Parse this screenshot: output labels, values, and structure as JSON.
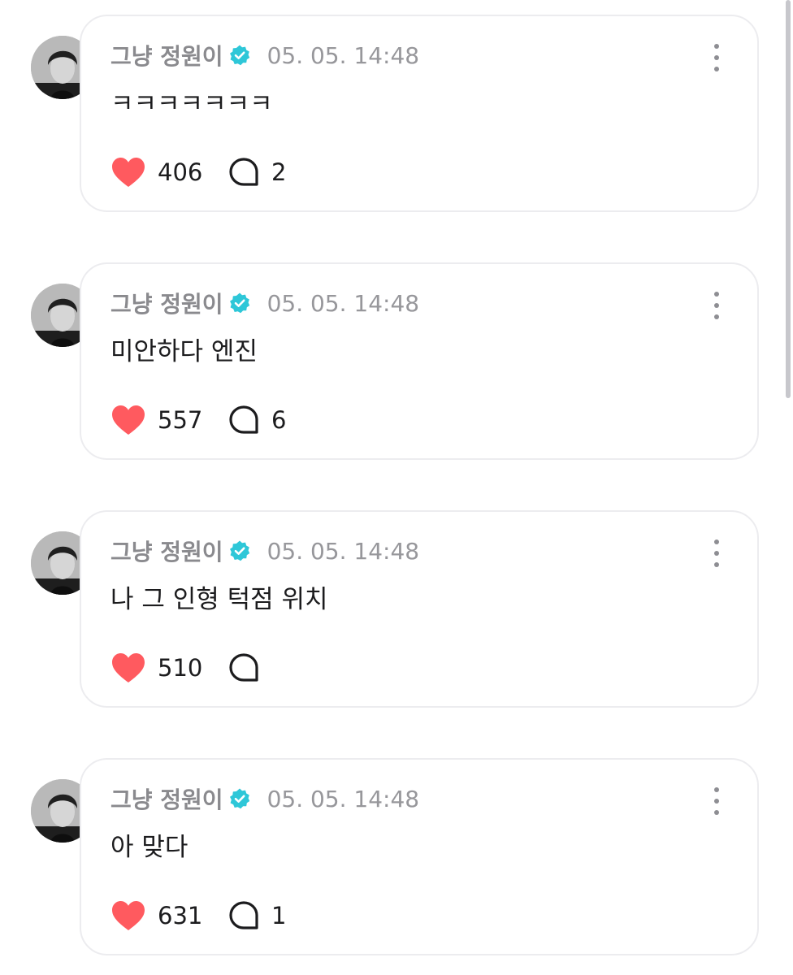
{
  "colors": {
    "heart": "#ff5a5f",
    "verified_badge": "#2ec7d8",
    "author_text": "#8a8a8e",
    "card_border": "#ececef"
  },
  "icons": {
    "verified": "verified-badge-icon",
    "like": "heart-icon",
    "comment": "comment-bubble-icon",
    "more": "more-vertical-icon"
  },
  "posts": [
    {
      "author": "그냥 정원이",
      "timestamp": "05. 05. 14:48",
      "text": "ㅋㅋㅋㅋㅋㅋㅋ",
      "likes": "406",
      "comments": "2"
    },
    {
      "author": "그냥 정원이",
      "timestamp": "05. 05. 14:48",
      "text": "미안하다 엔진",
      "likes": "557",
      "comments": "6"
    },
    {
      "author": "그냥 정원이",
      "timestamp": "05. 05. 14:48",
      "text": "나 그 인형 턱점 위치",
      "likes": "510",
      "comments": ""
    },
    {
      "author": "그냥 정원이",
      "timestamp": "05. 05. 14:48",
      "text": "아 맞다",
      "likes": "631",
      "comments": "1"
    }
  ]
}
